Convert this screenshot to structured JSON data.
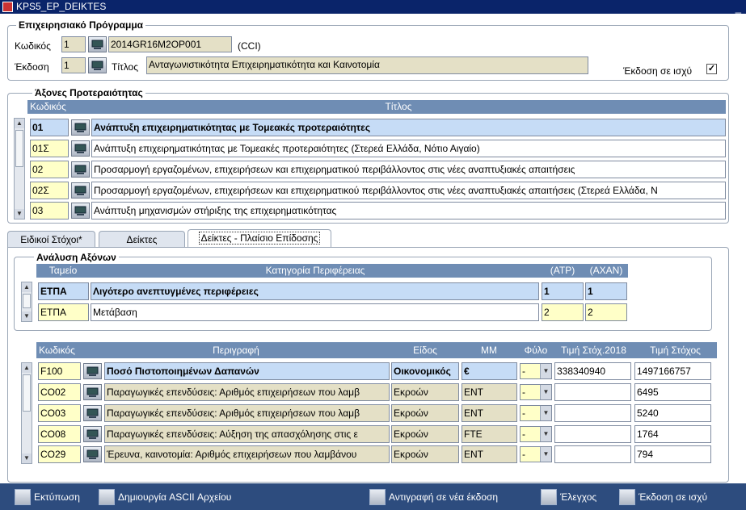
{
  "window": {
    "title": "KPS5_EP_DEIKTES",
    "minimize": "_"
  },
  "program": {
    "legend": "Επιχειρησιακό Πρόγραμμα",
    "code_label": "Κωδικός",
    "code_value": "1",
    "cci_value": "2014GR16M2OP001",
    "cci_suffix": "(CCI)",
    "version_label": "Έκδοση",
    "version_value": "1",
    "title_label": "Τίτλος",
    "title_value": "Ανταγωνιστικότητα Επιχειρηματικότητα και Καινοτομία",
    "active_label": "Έκδοση σε ισχύ",
    "active_check": "✓"
  },
  "axes": {
    "legend": "Άξονες Προτεραιότητας",
    "col_code": "Κωδικός",
    "col_title": "Τίτλος",
    "rows": [
      {
        "code": "01",
        "title": "Ανάπτυξη επιχειρηματικότητας με Τομεακές προτεραιότητες"
      },
      {
        "code": "01Σ",
        "title": "Ανάπτυξη επιχειρηματικότητας με Τομεακές προτεραιότητες (Στερεά Ελλάδα, Νότιο Αιγαίο)"
      },
      {
        "code": "02",
        "title": "Προσαρμογή εργαζομένων, επιχειρήσεων και επιχειρηματικού περιβάλλοντος στις νέες αναπτυξιακές απαιτήσεις"
      },
      {
        "code": "02Σ",
        "title": "Προσαρμογή εργαζομένων, επιχειρήσεων και επιχειρηματικού περιβάλλοντος στις νέες αναπτυξιακές απαιτήσεις (Στερεά Ελλάδα, Ν"
      },
      {
        "code": "03",
        "title": "Ανάπτυξη μηχανισμών στήριξης της επιχειρηματικότητας"
      }
    ]
  },
  "tabs": [
    {
      "label": "Ειδικοί Στόχοι*"
    },
    {
      "label": "Δείκτες"
    },
    {
      "label": "Δείκτες - Πλαίσιο Επίδοσης"
    }
  ],
  "analysis": {
    "legend": "Ανάλυση Αξόνων",
    "col_fund": "Ταμείο",
    "col_region": "Κατηγορία Περιφέρειας",
    "col_atp": "(ATP)",
    "col_axan": "(AXAN)",
    "rows": [
      {
        "fund": "ΕΤΠΑ",
        "region": "Λιγότερο ανεπτυγμένες περιφέρειες",
        "atp": "1",
        "axan": "1"
      },
      {
        "fund": "ΕΤΠΑ",
        "region": "Μετάβαση",
        "atp": "2",
        "axan": "2"
      }
    ]
  },
  "indicators": {
    "col_code": "Κωδικός",
    "col_desc": "Περιγραφή",
    "col_type": "Είδος",
    "col_unit": "ΜΜ",
    "col_gender": "Φύλο",
    "col_target2018": "Τιμή Στόχ.2018",
    "col_target": "Τιμή Στόχος",
    "rows": [
      {
        "code": "F100",
        "desc": "Ποσό Πιστοποιημένων Δαπανών",
        "type": "Οικονομικός",
        "unit": "€",
        "gender": "-",
        "t2018": "338340940",
        "target": "1497166757"
      },
      {
        "code": "CO02",
        "desc": "Παραγωγικές επενδύσεις: Αριθμός επιχειρήσεων που λαμβ",
        "type": "Εκροών",
        "unit": "ENT",
        "gender": "-",
        "t2018": "",
        "target": "6495"
      },
      {
        "code": "CO03",
        "desc": "Παραγωγικές επενδύσεις: Αριθμός επιχειρήσεων που λαμβ",
        "type": "Εκροών",
        "unit": "ENT",
        "gender": "-",
        "t2018": "",
        "target": "5240"
      },
      {
        "code": "CO08",
        "desc": "Παραγωγικές επενδύσεις: Αύξηση της απασχόλησης στις ε",
        "type": "Εκροών",
        "unit": "FTE",
        "gender": "-",
        "t2018": "",
        "target": "1764"
      },
      {
        "code": "CO29",
        "desc": "Έρευνα, καινοτομία: Αριθμός επιχειρήσεων που λαμβάνου",
        "type": "Εκροών",
        "unit": "ENT",
        "gender": "-",
        "t2018": "",
        "target": "794"
      }
    ]
  },
  "toolbar": {
    "print": "Εκτύπωση",
    "ascii": "Δημιουργία ASCII Αρχείου",
    "copy": "Αντιγραφή σε νέα έκδοση",
    "check": "Έλεγχος",
    "activate": "Έκδοση σε ισχύ"
  },
  "colors": {
    "header": "#6f8db4",
    "selected_row": "#c6dcf6",
    "required_field": "#ffffc8",
    "toolbar": "#2d4c7e"
  }
}
